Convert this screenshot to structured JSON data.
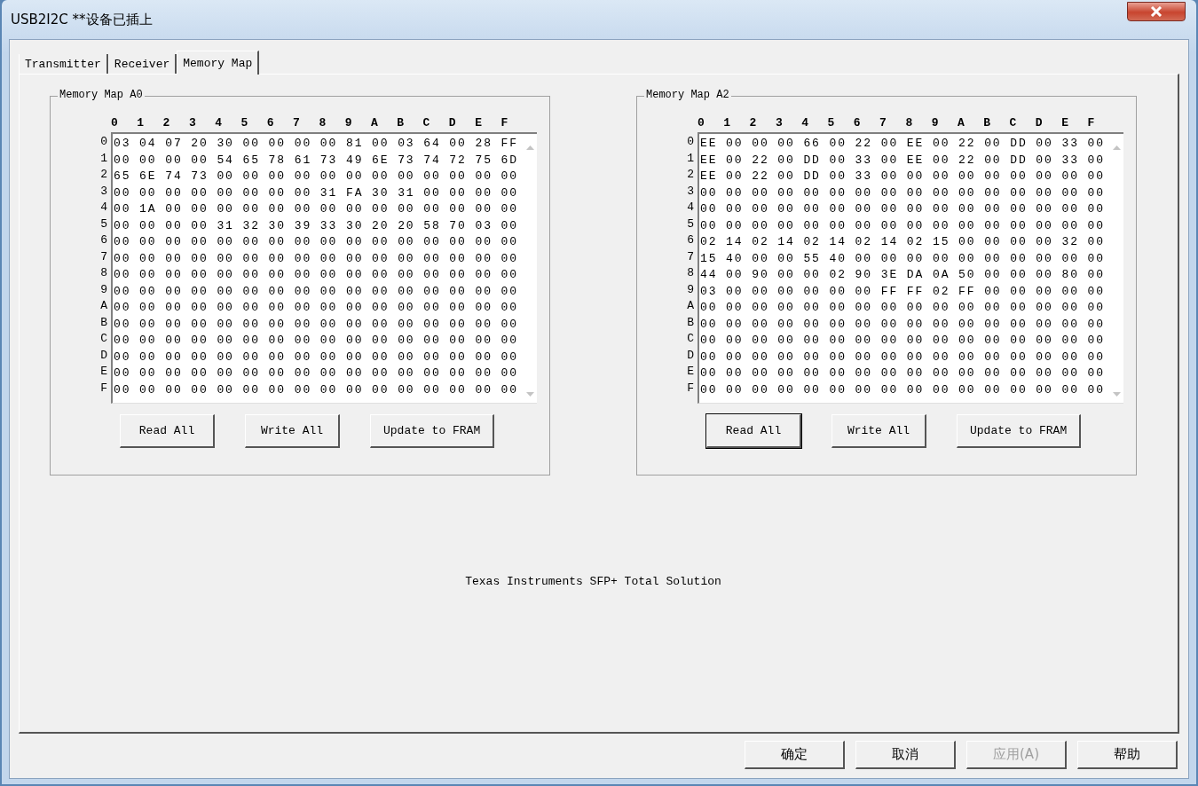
{
  "window": {
    "title": "USB2I2C **设备已插上"
  },
  "tabs": [
    {
      "label": "Transmitter",
      "selected": false
    },
    {
      "label": "Receiver",
      "selected": false
    },
    {
      "label": "Memory Map",
      "selected": true
    }
  ],
  "memory_maps": [
    {
      "title": "Memory Map A0",
      "columns": [
        "0",
        "1",
        "2",
        "3",
        "4",
        "5",
        "6",
        "7",
        "8",
        "9",
        "A",
        "B",
        "C",
        "D",
        "E",
        "F"
      ],
      "row_labels": [
        "0",
        "1",
        "2",
        "3",
        "4",
        "5",
        "6",
        "7",
        "8",
        "9",
        "A",
        "B",
        "C",
        "D",
        "E",
        "F"
      ],
      "rows": [
        "03 04 07 20 30 00 00 00 00 81 00 03 64 00 28 FF",
        "00 00 00 00 54 65 78 61 73 49 6E 73 74 72 75 6D",
        "65 6E 74 73 00 00 00 00 00 00 00 00 00 00 00 00",
        "00 00 00 00 00 00 00 00 31 FA 30 31 00 00 00 00",
        "00 1A 00 00 00 00 00 00 00 00 00 00 00 00 00 00",
        "00 00 00 00 31 32 30 39 33 30 20 20 58 70 03 00",
        "00 00 00 00 00 00 00 00 00 00 00 00 00 00 00 00",
        "00 00 00 00 00 00 00 00 00 00 00 00 00 00 00 00",
        "00 00 00 00 00 00 00 00 00 00 00 00 00 00 00 00",
        "00 00 00 00 00 00 00 00 00 00 00 00 00 00 00 00",
        "00 00 00 00 00 00 00 00 00 00 00 00 00 00 00 00",
        "00 00 00 00 00 00 00 00 00 00 00 00 00 00 00 00",
        "00 00 00 00 00 00 00 00 00 00 00 00 00 00 00 00",
        "00 00 00 00 00 00 00 00 00 00 00 00 00 00 00 00",
        "00 00 00 00 00 00 00 00 00 00 00 00 00 00 00 00",
        "00 00 00 00 00 00 00 00 00 00 00 00 00 00 00 00"
      ],
      "buttons": [
        {
          "label": "Read All",
          "focused": false
        },
        {
          "label": "Write All",
          "focused": false
        },
        {
          "label": "Update to FRAM",
          "focused": false
        }
      ]
    },
    {
      "title": "Memory Map A2",
      "columns": [
        "0",
        "1",
        "2",
        "3",
        "4",
        "5",
        "6",
        "7",
        "8",
        "9",
        "A",
        "B",
        "C",
        "D",
        "E",
        "F"
      ],
      "row_labels": [
        "0",
        "1",
        "2",
        "3",
        "4",
        "5",
        "6",
        "7",
        "8",
        "9",
        "A",
        "B",
        "C",
        "D",
        "E",
        "F"
      ],
      "rows": [
        "EE 00 00 00 66 00 22 00 EE 00 22 00 DD 00 33 00",
        "EE 00 22 00 DD 00 33 00 EE 00 22 00 DD 00 33 00",
        "EE 00 22 00 DD 00 33 00 00 00 00 00 00 00 00 00",
        "00 00 00 00 00 00 00 00 00 00 00 00 00 00 00 00",
        "00 00 00 00 00 00 00 00 00 00 00 00 00 00 00 00",
        "00 00 00 00 00 00 00 00 00 00 00 00 00 00 00 00",
        "02 14 02 14 02 14 02 14 02 15 00 00 00 00 32 00",
        "15 40 00 00 55 40 00 00 00 00 00 00 00 00 00 00",
        "44 00 90 00 00 02 90 3E DA 0A 50 00 00 00 80 00",
        "03 00 00 00 00 00 00 FF FF 02 FF 00 00 00 00 00",
        "00 00 00 00 00 00 00 00 00 00 00 00 00 00 00 00",
        "00 00 00 00 00 00 00 00 00 00 00 00 00 00 00 00",
        "00 00 00 00 00 00 00 00 00 00 00 00 00 00 00 00",
        "00 00 00 00 00 00 00 00 00 00 00 00 00 00 00 00",
        "00 00 00 00 00 00 00 00 00 00 00 00 00 00 00 00",
        "00 00 00 00 00 00 00 00 00 00 00 00 00 00 00 00"
      ],
      "buttons": [
        {
          "label": "Read All",
          "focused": true
        },
        {
          "label": "Write All",
          "focused": false
        },
        {
          "label": "Update to FRAM",
          "focused": false
        }
      ]
    }
  ],
  "footer_text": "Texas Instruments SFP+ Total Solution",
  "dialog_buttons": [
    {
      "label": "确定",
      "disabled": false
    },
    {
      "label": "取消",
      "disabled": false
    },
    {
      "label": "应用(A)",
      "disabled": true
    },
    {
      "label": "帮助",
      "disabled": false
    }
  ]
}
